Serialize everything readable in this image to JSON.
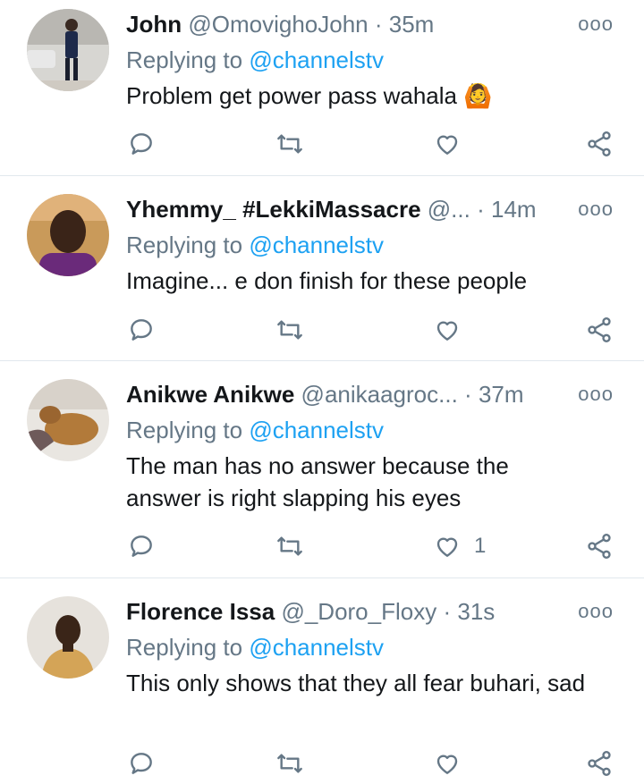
{
  "tweets": [
    {
      "name": "John",
      "handle": "@OmovighoJohn",
      "separator": "·",
      "time": "35m",
      "replying_prefix": "Replying to",
      "replying_to": "@channelstv",
      "text": "Problem get power pass wahala",
      "emoji": "🙆",
      "like_count": ""
    },
    {
      "name": "Yhemmy_ #LekkiMassacre",
      "handle": "@...",
      "separator": "·",
      "time": "14m",
      "replying_prefix": "Replying to",
      "replying_to": "@channelstv",
      "text": "Imagine... e don finish for these people",
      "like_count": ""
    },
    {
      "name": "Anikwe Anikwe",
      "handle": "@anikaagroc...",
      "separator": "·",
      "time": "37m",
      "replying_prefix": "Replying to",
      "replying_to": "@channelstv",
      "text": "The man has no answer because the answer is right slapping his eyes",
      "like_count": "1"
    },
    {
      "name": "Florence Issa",
      "handle": "@_Doro_Floxy",
      "separator": "·",
      "time": "31s",
      "replying_prefix": "Replying to",
      "replying_to": "@channelstv",
      "text": "This only shows that they all fear buhari, sad",
      "like_count": ""
    }
  ],
  "menu_glyph": "ooo",
  "icons": [
    "reply-icon",
    "retweet-icon",
    "like-icon",
    "share-icon",
    "more-icon"
  ],
  "colors": {
    "secondary": "#657786",
    "mention": "#1da1f2",
    "divider": "#e1e8ed"
  }
}
